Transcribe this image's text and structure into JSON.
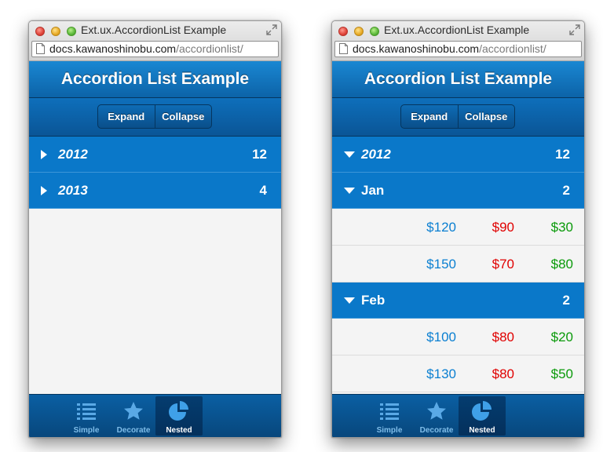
{
  "windows": [
    {
      "id": "left",
      "window_title": "Ext.ux.AccordionList Example",
      "url_host": "docs.kawanoshinobu.com",
      "url_path": "/accordionlist/",
      "app_title": "Accordion List Example",
      "segmented": {
        "expand": "Expand",
        "collapse": "Collapse"
      },
      "rows": [
        {
          "type": "header",
          "label": "2012",
          "count": "12",
          "expanded": false,
          "year": true
        },
        {
          "type": "header",
          "label": "2013",
          "count": "4",
          "expanded": false,
          "year": true
        }
      ],
      "tabs": [
        {
          "label": "Simple",
          "icon": "list-icon",
          "active": false
        },
        {
          "label": "Decorate",
          "icon": "star-icon",
          "active": false
        },
        {
          "label": "Nested",
          "icon": "pie-chart-icon",
          "active": true
        }
      ]
    },
    {
      "id": "right",
      "window_title": "Ext.ux.AccordionList Example",
      "url_host": "docs.kawanoshinobu.com",
      "url_path": "/accordionlist/",
      "app_title": "Accordion List Example",
      "segmented": {
        "expand": "Expand",
        "collapse": "Collapse"
      },
      "rows": [
        {
          "type": "header",
          "label": "2012",
          "count": "12",
          "expanded": true,
          "year": true
        },
        {
          "type": "header",
          "label": "Jan",
          "count": "2",
          "expanded": true,
          "year": false
        },
        {
          "type": "item",
          "values": [
            "$120",
            "$90",
            "$30"
          ]
        },
        {
          "type": "item",
          "values": [
            "$150",
            "$70",
            "$80"
          ]
        },
        {
          "type": "header",
          "label": "Feb",
          "count": "2",
          "expanded": true,
          "year": false
        },
        {
          "type": "item",
          "values": [
            "$100",
            "$80",
            "$20"
          ]
        },
        {
          "type": "item",
          "values": [
            "$130",
            "$80",
            "$50"
          ]
        }
      ],
      "tabs": [
        {
          "label": "Simple",
          "icon": "list-icon",
          "active": false
        },
        {
          "label": "Decorate",
          "icon": "star-icon",
          "active": false
        },
        {
          "label": "Nested",
          "icon": "pie-chart-icon",
          "active": true
        }
      ]
    }
  ],
  "colors": {
    "header_blue": "#0a78c9",
    "value_blue": "#0a7fd1",
    "value_red": "#e00000",
    "value_green": "#0a9a0a"
  }
}
